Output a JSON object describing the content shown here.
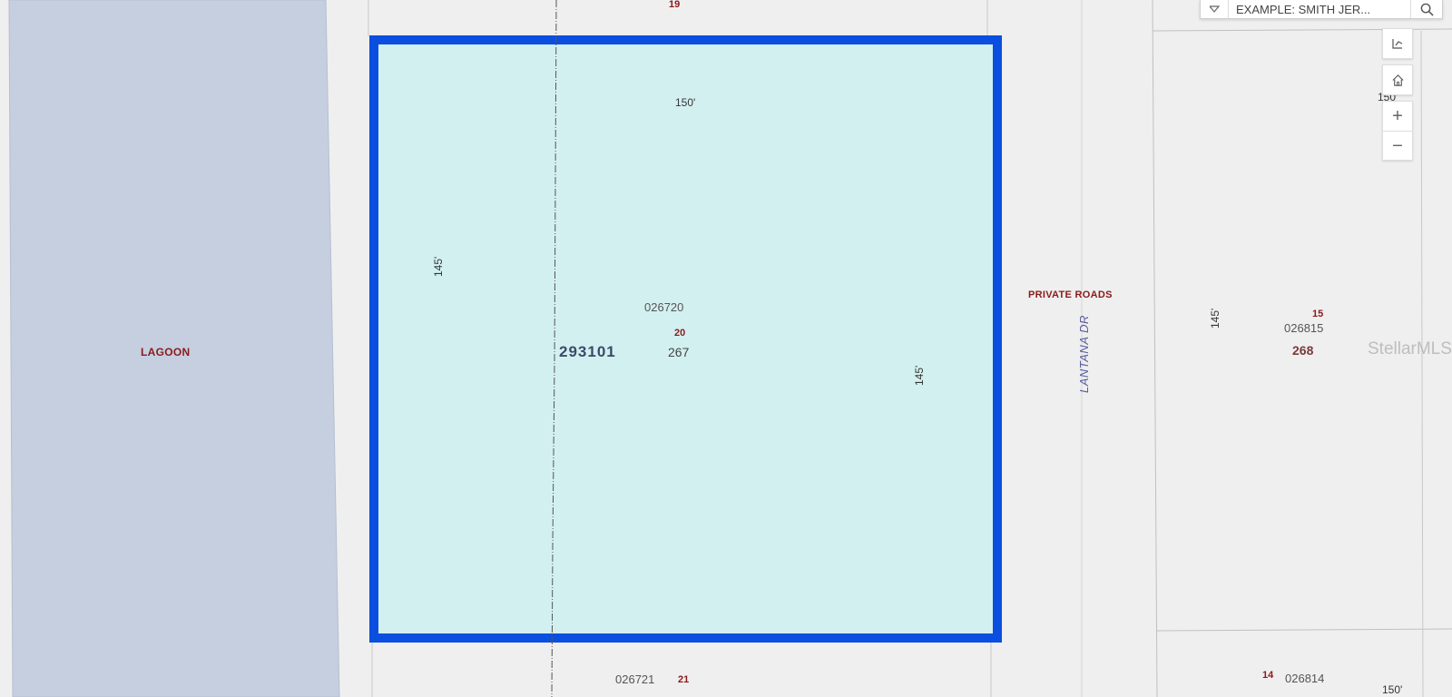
{
  "map": {
    "water_label": "LAGOON",
    "top_lot": "19",
    "subject_parcel": {
      "dim_top": "150'",
      "dim_left": "145'",
      "dim_right": "145'",
      "parcel_id": "026720",
      "lot": "20",
      "block_code": "293101",
      "block": "267"
    },
    "road_owner_label": "PRIVATE ROADS",
    "street_name": "LANTANA DR",
    "east_parcel": {
      "dim_top": "150'",
      "dim_left": "145'",
      "lot": "15",
      "parcel_id": "026815",
      "block": "268"
    },
    "south_parcel": {
      "parcel_id": "026721",
      "lot": "21"
    },
    "southeast_parcel": {
      "lot": "14",
      "parcel_id": "026814",
      "dim_bottom": "150'"
    },
    "watermark": "StellarMLS"
  },
  "toolbar": {
    "search_placeholder": "EXAMPLE: SMITH JER...",
    "zoom_in": "+",
    "zoom_out": "−"
  },
  "colors": {
    "water": "#c5cfe0",
    "parcel_fill": "#d3f0f0",
    "parcel_outline": "#0a4fe0",
    "label_red": "#8b1a1a",
    "street_label": "#5a5fa0"
  }
}
